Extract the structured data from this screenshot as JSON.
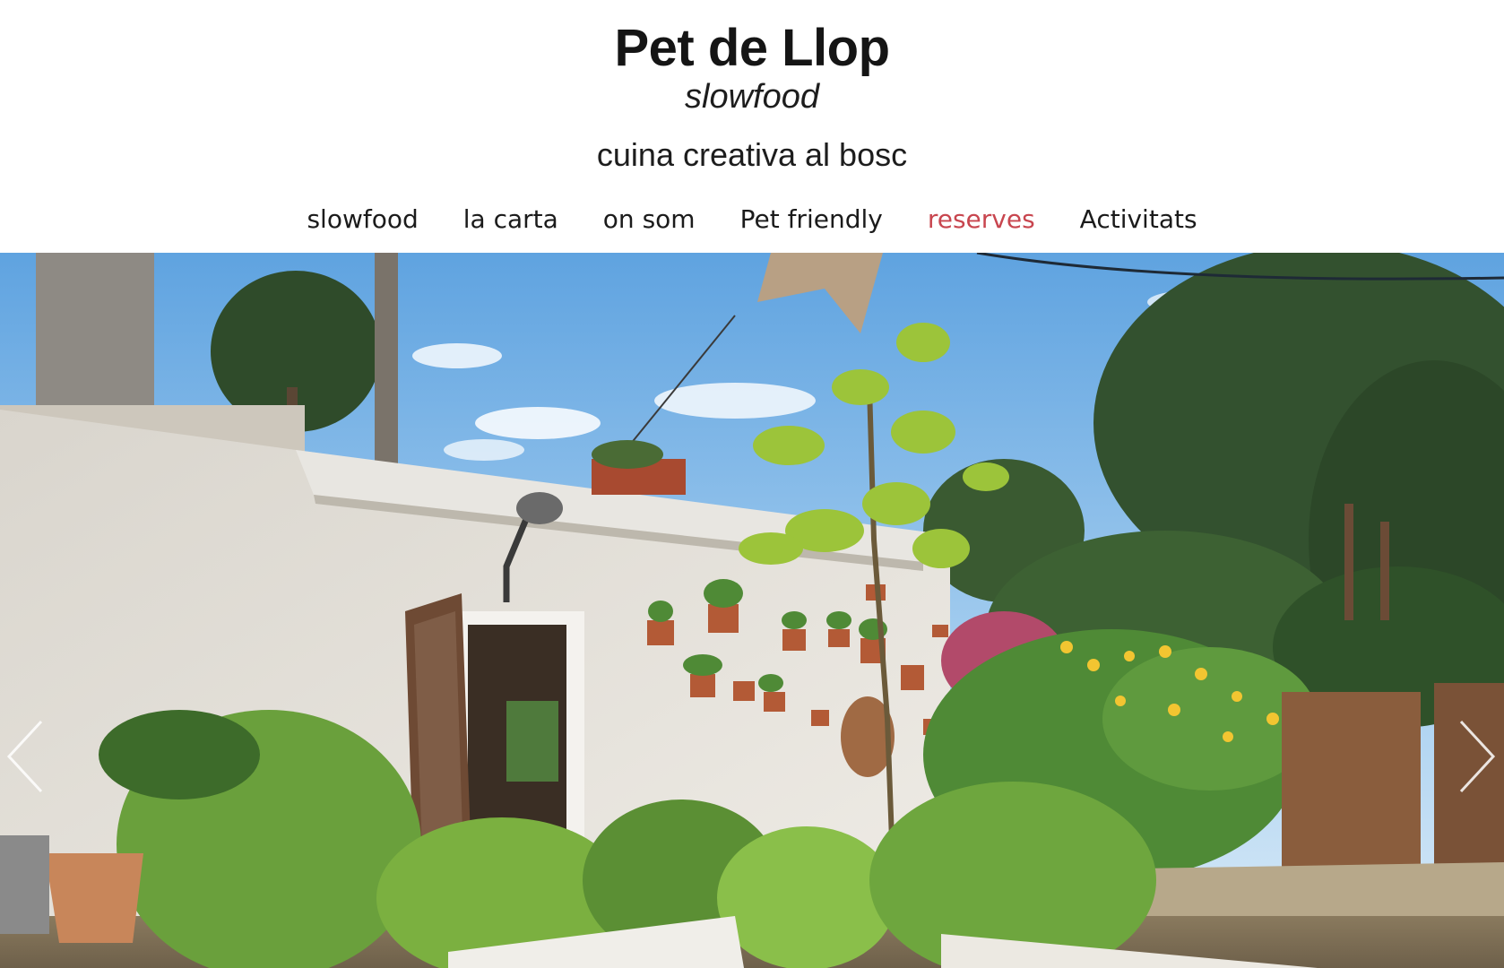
{
  "site": {
    "title": "Pet de Llop",
    "subtitle": "slowfood",
    "tagline": "cuina creativa al bosc"
  },
  "nav": {
    "items": [
      {
        "label": "slowfood"
      },
      {
        "label": "la carta"
      },
      {
        "label": "on som"
      },
      {
        "label": "Pet friendly"
      },
      {
        "label": "reserves",
        "active": true
      },
      {
        "label": "Activitats"
      }
    ],
    "active_color": "#c8464f"
  },
  "slider": {
    "image": "garden-house-photo",
    "prev_icon": "chevron-left-icon",
    "next_icon": "chevron-right-icon"
  }
}
